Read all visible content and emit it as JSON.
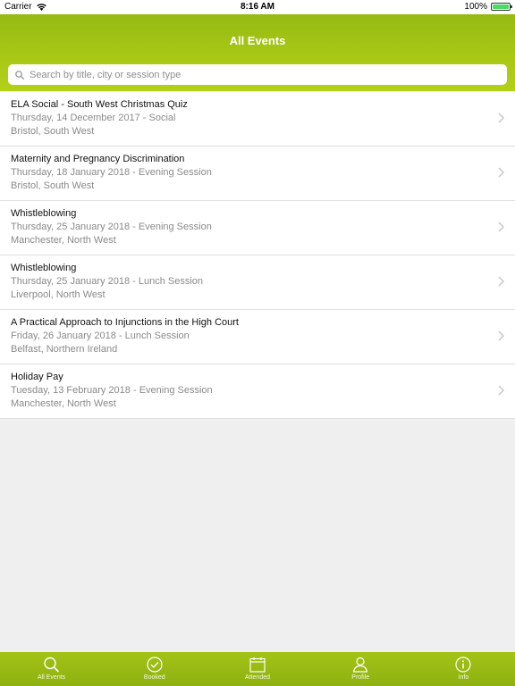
{
  "status": {
    "carrier": "Carrier",
    "time": "8:16 AM",
    "battery": "100%"
  },
  "nav": {
    "title": "All Events"
  },
  "search": {
    "placeholder": "Search by title, city or session type"
  },
  "events": [
    {
      "title": "ELA Social - South West Christmas Quiz",
      "date": "Thursday, 14 December 2017 - Social",
      "location": "Bristol, South West"
    },
    {
      "title": "Maternity and Pregnancy Discrimination",
      "date": "Thursday, 18 January 2018 - Evening Session",
      "location": "Bristol, South West"
    },
    {
      "title": "Whistleblowing",
      "date": "Thursday, 25 January 2018 - Evening Session",
      "location": "Manchester, North West"
    },
    {
      "title": "Whistleblowing",
      "date": "Thursday, 25 January 2018 - Lunch Session",
      "location": "Liverpool, North West"
    },
    {
      "title": "A Practical Approach to Injunctions in the High Court",
      "date": "Friday, 26 January 2018 - Lunch Session",
      "location": "Belfast, Northern Ireland"
    },
    {
      "title": "Holiday Pay",
      "date": "Tuesday, 13 February 2018 - Evening Session",
      "location": "Manchester, North West"
    }
  ],
  "tabs": [
    {
      "label": "All Events",
      "icon": "search-icon"
    },
    {
      "label": "Booked",
      "icon": "checkmark-circle-icon"
    },
    {
      "label": "Attended",
      "icon": "calendar-icon"
    },
    {
      "label": "Profile",
      "icon": "person-icon"
    },
    {
      "label": "Info",
      "icon": "info-icon"
    }
  ],
  "colors": {
    "brand_green": "#9dc014",
    "battery_green": "#4cd964"
  }
}
